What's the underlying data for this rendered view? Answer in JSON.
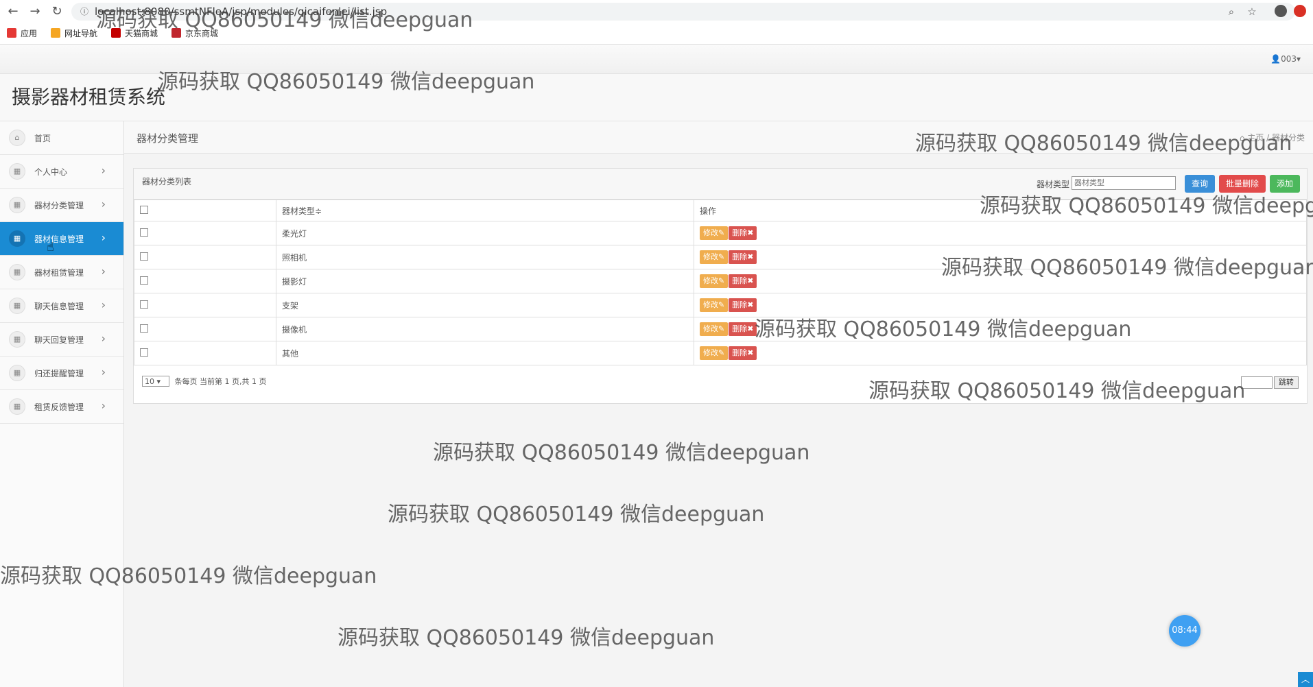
{
  "browser": {
    "url": "localhost:8080/ssmtNFleA/jsp/modules/qicaifenlei/list.jsp",
    "bookmarks": [
      "应用",
      "网址导航",
      "天猫商城",
      "京东商城"
    ]
  },
  "header": {
    "user": "003",
    "app_title": "摄影器材租赁系统"
  },
  "sidebar": {
    "items": [
      {
        "label": "首页",
        "icon": "home-icon",
        "active": false,
        "chevron": false
      },
      {
        "label": "个人中心",
        "icon": "grid-icon",
        "active": false,
        "chevron": true
      },
      {
        "label": "器材分类管理",
        "icon": "grid-icon",
        "active": false,
        "chevron": true
      },
      {
        "label": "器材信息管理",
        "icon": "grid-icon",
        "active": true,
        "chevron": true
      },
      {
        "label": "器材租赁管理",
        "icon": "grid-icon",
        "active": false,
        "chevron": true
      },
      {
        "label": "聊天信息管理",
        "icon": "grid-icon",
        "active": false,
        "chevron": true
      },
      {
        "label": "聊天回复管理",
        "icon": "grid-icon",
        "active": false,
        "chevron": true
      },
      {
        "label": "归还提醒管理",
        "icon": "grid-icon",
        "active": false,
        "chevron": true
      },
      {
        "label": "租赁反馈管理",
        "icon": "grid-icon",
        "active": false,
        "chevron": true
      }
    ]
  },
  "page": {
    "title": "器材分类管理",
    "breadcrumb": [
      "主页",
      "器材分类"
    ]
  },
  "panel": {
    "title": "器材分类列表",
    "search_label": "器材类型",
    "search_placeholder": "器材类型",
    "query_label": "查询",
    "batch_delete_label": "批量删除",
    "add_label": "添加"
  },
  "table": {
    "columns": [
      "",
      "器材类型≑",
      "操作"
    ],
    "edit_label": "修改✎",
    "delete_label": "删除✖",
    "rows": [
      {
        "type": "柔光灯"
      },
      {
        "type": "照相机"
      },
      {
        "type": "摄影灯"
      },
      {
        "type": "支架"
      },
      {
        "type": "摄像机"
      },
      {
        "type": "其他"
      }
    ]
  },
  "pager": {
    "page_size": "10",
    "info": "条每页 当前第 1 页,共 1 页",
    "jump_label": "跳转"
  },
  "clock": "08:44",
  "watermark": "源码获取 QQ86050149 微信deepguan",
  "colors": {
    "active": "#1a8bd3",
    "query": "#3a8fd8",
    "danger": "#e24b4b",
    "add": "#4cb85c",
    "edit": "#f0ad4e"
  }
}
